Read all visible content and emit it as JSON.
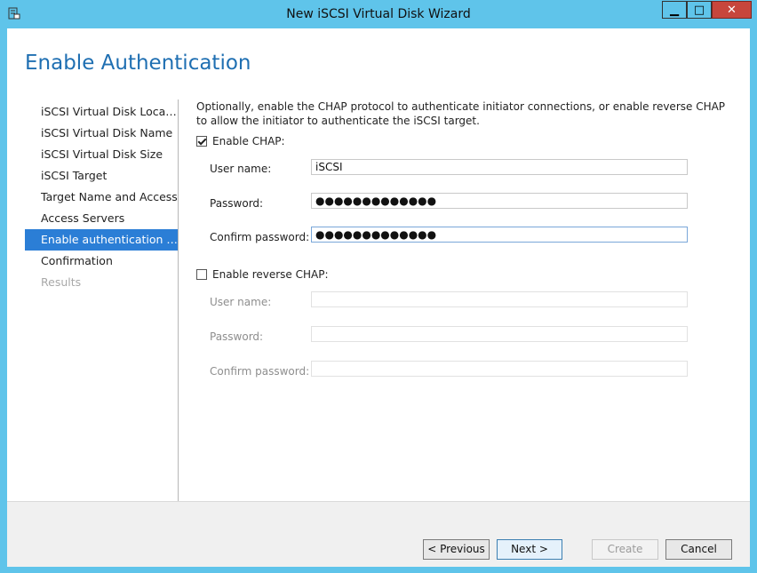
{
  "window": {
    "title": "New iSCSI Virtual Disk Wizard",
    "minimize_glyph": "▁",
    "maximize_glyph": "□",
    "close_glyph": "✕"
  },
  "page": {
    "title": "Enable Authentication"
  },
  "steps": [
    {
      "label": "iSCSI Virtual Disk Location",
      "state": "done"
    },
    {
      "label": "iSCSI Virtual Disk Name",
      "state": "done"
    },
    {
      "label": "iSCSI Virtual Disk Size",
      "state": "done"
    },
    {
      "label": "iSCSI Target",
      "state": "done"
    },
    {
      "label": "Target Name and Access",
      "state": "done"
    },
    {
      "label": "Access Servers",
      "state": "done"
    },
    {
      "label": "Enable authentication ser...",
      "state": "active"
    },
    {
      "label": "Confirmation",
      "state": "pending"
    },
    {
      "label": "Results",
      "state": "disabled"
    }
  ],
  "content": {
    "description": "Optionally, enable the CHAP protocol to authenticate initiator connections, or enable reverse CHAP to allow the initiator to authenticate the iSCSI target.",
    "chap": {
      "label": "Enable CHAP:",
      "checked": true,
      "user_label": "User name:",
      "user_value": "iSCSI",
      "password_label": "Password:",
      "password_value": "●●●●●●●●●●●●●",
      "confirm_label": "Confirm password:",
      "confirm_value": "●●●●●●●●●●●●●"
    },
    "reverse_chap": {
      "label": "Enable reverse CHAP:",
      "checked": false,
      "user_label": "User name:",
      "password_label": "Password:",
      "confirm_label": "Confirm password:"
    }
  },
  "buttons": {
    "previous": "< Previous",
    "next": "Next >",
    "create": "Create",
    "cancel": "Cancel"
  },
  "colors": {
    "titlebar": "#5fc4ea",
    "accent": "#2b7ed6",
    "title_text": "#1f6fb2",
    "close": "#c7463c"
  }
}
